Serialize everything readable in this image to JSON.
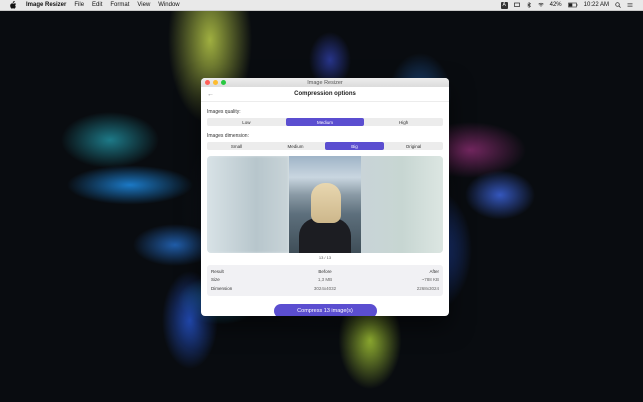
{
  "menubar": {
    "app_name": "Image Resizer",
    "menus": [
      "File",
      "Edit",
      "Format",
      "View",
      "Window"
    ],
    "keyboard_indicator": "A",
    "battery": "42%",
    "clock": "10:22 AM"
  },
  "window": {
    "title": "Image Resizer",
    "header_title": "Compression options",
    "back_icon": "←"
  },
  "quality": {
    "label": "Images quality:",
    "options": [
      "Low",
      "Medium",
      "High"
    ],
    "selected": "Medium"
  },
  "dimension": {
    "label": "Images dimension:",
    "options": [
      "Small",
      "Medium",
      "Big",
      "Original"
    ],
    "selected": "Big"
  },
  "preview": {
    "counter": "13 / 13"
  },
  "stats": {
    "headers": [
      "Result",
      "Before",
      "After"
    ],
    "rows": [
      {
        "label": "Size",
        "before": "1,3 MB",
        "after": "~788 KB"
      },
      {
        "label": "Dimension",
        "before": "3024x4032",
        "after": "2268x3024"
      }
    ]
  },
  "action": {
    "compress_label": "Compress 13 image(s)"
  },
  "colors": {
    "accent": "#5b4ed0"
  }
}
